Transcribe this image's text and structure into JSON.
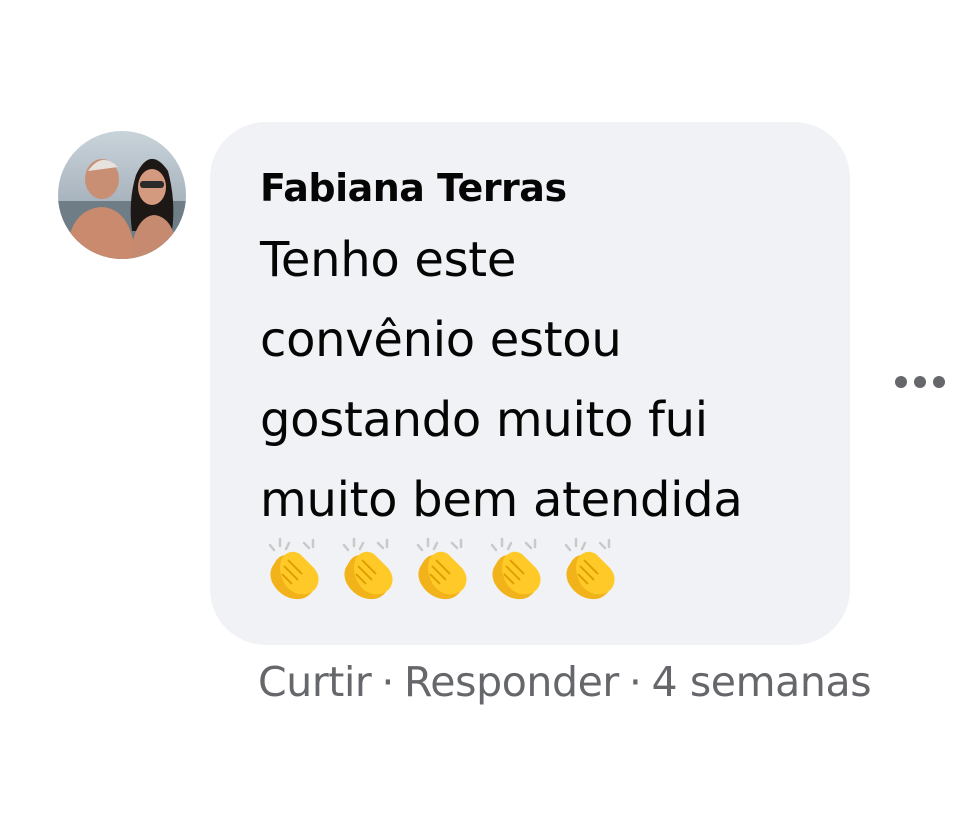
{
  "comment": {
    "author": "Fabiana Terras",
    "text_lines": [
      "Tenho este",
      "convênio estou",
      "gostando muito fui",
      "muito bem atendida"
    ],
    "emoji": [
      "👏",
      "👏",
      "👏",
      "👏",
      "👏"
    ],
    "emoji_icon": "clapping-hands-icon",
    "more_icon": "more-options-icon",
    "bubble_color": "#f0f2f5",
    "meta_color": "#65676b"
  },
  "actions": {
    "like_label": "Curtir",
    "separator": "·",
    "reply_label": "Responder",
    "timestamp": "4 semanas"
  }
}
